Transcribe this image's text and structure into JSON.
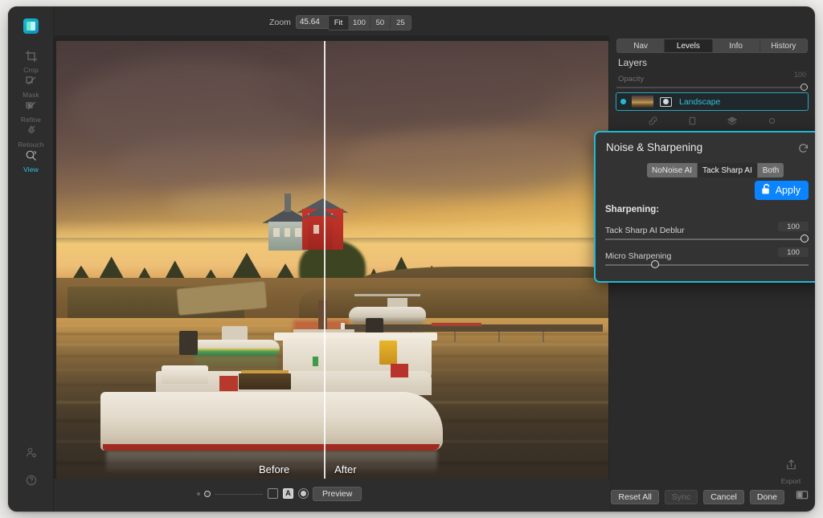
{
  "app": {
    "logo_icon": "app-logo-icon"
  },
  "toolrail": {
    "items": [
      {
        "label": "Crop",
        "icon": "crop-icon",
        "active": false
      },
      {
        "label": "Mask",
        "icon": "mask-icon",
        "active": false
      },
      {
        "label": "Refine",
        "icon": "refine-icon",
        "active": false
      },
      {
        "label": "Retouch",
        "icon": "retouch-icon",
        "active": false
      },
      {
        "label": "View",
        "icon": "view-icon",
        "active": true
      }
    ],
    "bottom": [
      {
        "icon": "account-icon"
      },
      {
        "icon": "help-icon"
      }
    ]
  },
  "topbar": {
    "zoom_label": "Zoom",
    "zoom_value": "45.64",
    "zoom_caret_icon": "chevron-down-icon",
    "presets": [
      {
        "label": "Fit",
        "selected": true
      },
      {
        "label": "100",
        "selected": false
      },
      {
        "label": "50",
        "selected": false
      },
      {
        "label": "25",
        "selected": false
      }
    ]
  },
  "canvas": {
    "before_label": "Before",
    "after_label": "After"
  },
  "bottombar": {
    "view_toggles": [
      {
        "icon": "square-view-icon",
        "label": "",
        "selected": false
      },
      {
        "icon": "letter-a-icon",
        "label": "A",
        "selected": true
      },
      {
        "icon": "circle-view-icon",
        "label": "",
        "selected": false
      }
    ],
    "preview_label": "Preview"
  },
  "right_panel": {
    "tabs": [
      {
        "label": "Nav",
        "selected": false
      },
      {
        "label": "Levels",
        "selected": true
      },
      {
        "label": "Info",
        "selected": false
      },
      {
        "label": "History",
        "selected": false
      }
    ],
    "layers_title": "Layers",
    "opacity_label": "Opacity",
    "opacity_value": "100",
    "layer": {
      "name": "Landscape",
      "visibility_icon": "visibility-dot-icon",
      "thumbnail_icon": "layer-thumbnail",
      "mask_icon": "layer-mask-icon"
    },
    "layer_tools": [
      {
        "icon": "link-layers-icon"
      },
      {
        "icon": "duplicate-layer-icon"
      },
      {
        "icon": "merge-layers-icon"
      },
      {
        "icon": "delete-layer-icon"
      }
    ]
  },
  "dialog": {
    "title": "Noise & Sharpening",
    "reset_icon": "reset-arrow-icon",
    "segments": [
      {
        "label": "NoNoise AI",
        "selected": false
      },
      {
        "label": "Tack Sharp AI",
        "selected": true
      },
      {
        "label": "Both",
        "selected": false
      }
    ],
    "apply_label": "Apply",
    "apply_icon": "unlock-icon",
    "section_label": "Sharpening:",
    "sliders": [
      {
        "label": "Tack Sharp AI Deblur",
        "value": "100",
        "position_pct": 100
      },
      {
        "label": "Micro Sharpening",
        "value": "100",
        "position_pct": 24
      }
    ]
  },
  "footer": {
    "export_label": "Export",
    "export_icon": "export-icon",
    "actions": [
      {
        "label": "Reset All",
        "disabled": false
      },
      {
        "label": "Sync",
        "disabled": true
      },
      {
        "label": "Cancel",
        "disabled": false
      },
      {
        "label": "Done",
        "disabled": false
      }
    ],
    "split_view_icon": "split-view-icon"
  },
  "colors": {
    "accent": "#2fc0dc",
    "apply_blue": "#0a84ff",
    "dialog_border": "#1fb9d4",
    "panel_bg": "#2b2b2b"
  }
}
